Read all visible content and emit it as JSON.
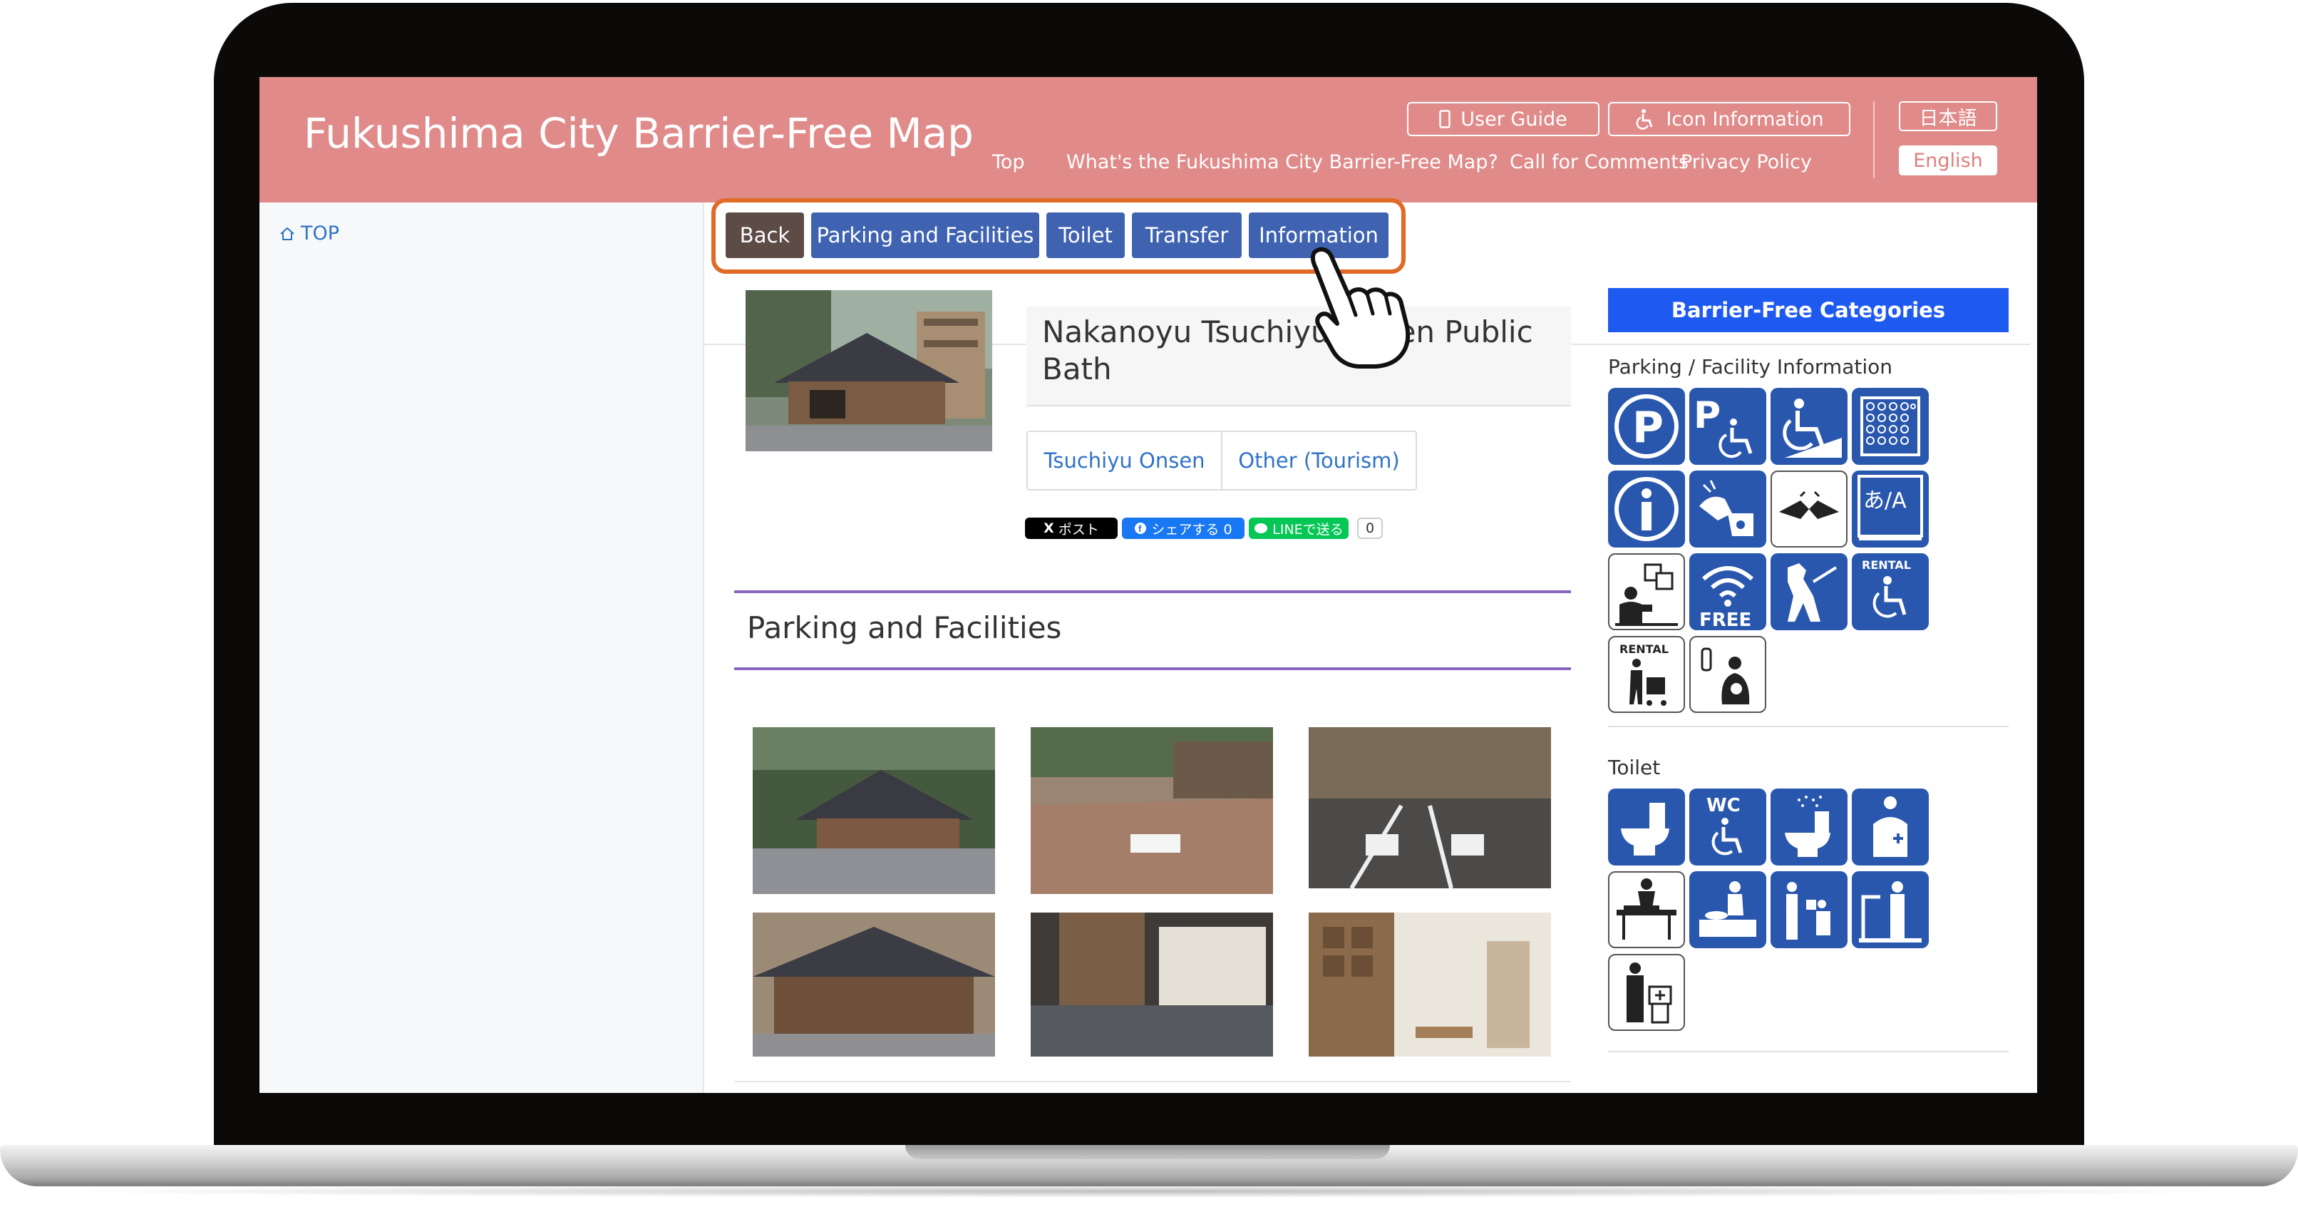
{
  "site": {
    "title": "Fukushima City Barrier-Free Map"
  },
  "header": {
    "buttons": {
      "user_guide": "User Guide",
      "icon_info": "Icon Information"
    },
    "nav": [
      "Top",
      "What's the Fukushima City Barrier-Free Map?",
      "Call for Comments",
      "Privacy Policy"
    ],
    "lang": {
      "japanese": "日本語",
      "english": "English"
    }
  },
  "sidebar": {
    "top_link": "TOP"
  },
  "tabs": [
    "Back",
    "Parking and Facilities",
    "Toilet",
    "Transfer",
    "Information"
  ],
  "place": {
    "title": "Nakanoyu Tsuchiyu Onsen Public Bath",
    "tags": [
      "Tsuchiyu Onsen",
      "Other (Tourism)"
    ]
  },
  "share": {
    "post": "ポスト",
    "facebook": "シェアする 0",
    "line": "LINEで送る",
    "count": "0"
  },
  "section": {
    "title": "Parking and Facilities"
  },
  "categories": {
    "header": "Barrier-Free Categories",
    "parking_heading": "Parking / Facility Information",
    "parking_icons": [
      "parking-icon",
      "accessible-parking-icon",
      "wheelchair-slope-icon",
      "tactile-paving-icon",
      "information-icon",
      "assistance-icon",
      "sign-language-icon",
      "multilingual-icon",
      "interpreter-icon",
      "free-wifi-icon",
      "assistance-dog-icon",
      "wheelchair-rental-icon",
      "stroller-rental-icon",
      "nursing-room-icon"
    ],
    "rental_label": "RENTAL",
    "wifi_label": "FREE",
    "wc_label": "WC",
    "multilingual_label": "あ/A",
    "toilet_heading": "Toilet",
    "toilet_icons": [
      "western-toilet-icon",
      "accessible-wc-icon",
      "washlet-icon",
      "ostomate-icon",
      "adult-changing-bed-icon",
      "baby-changing-table-icon",
      "baby-seat-icon",
      "handrail-icon",
      "ostomate-sink-icon"
    ]
  },
  "colors": {
    "header": "#e08a89",
    "tab": "#3f63b1",
    "back": "#5d4b46",
    "category_header": "#1f5af0",
    "icon_blue": "#2957ae",
    "highlight": "#e06a26"
  }
}
